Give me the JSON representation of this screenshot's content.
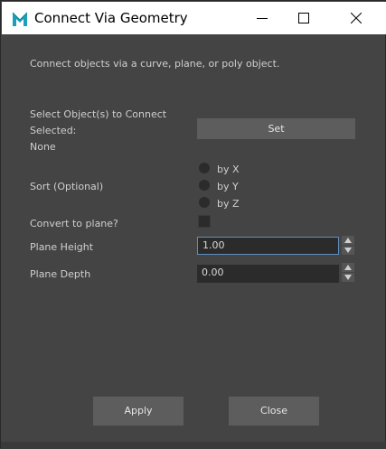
{
  "window": {
    "title": "Connect Via Geometry",
    "app_icon": "maya-logo-icon"
  },
  "description": "Connect objects via a curve, plane, or poly object.",
  "selection": {
    "label": "Select Object(s) to Connect",
    "selected_label": "Selected:",
    "selected_value": "None",
    "set_button": "Set"
  },
  "sort": {
    "label": "Sort (Optional)",
    "options": [
      "by X",
      "by Y",
      "by Z"
    ]
  },
  "convert": {
    "label": "Convert to plane?",
    "checked": false
  },
  "plane_height": {
    "label": "Plane Height",
    "value": "1.00"
  },
  "plane_depth": {
    "label": "Plane Depth",
    "value": "0.00"
  },
  "actions": {
    "apply": "Apply",
    "close": "Close"
  }
}
